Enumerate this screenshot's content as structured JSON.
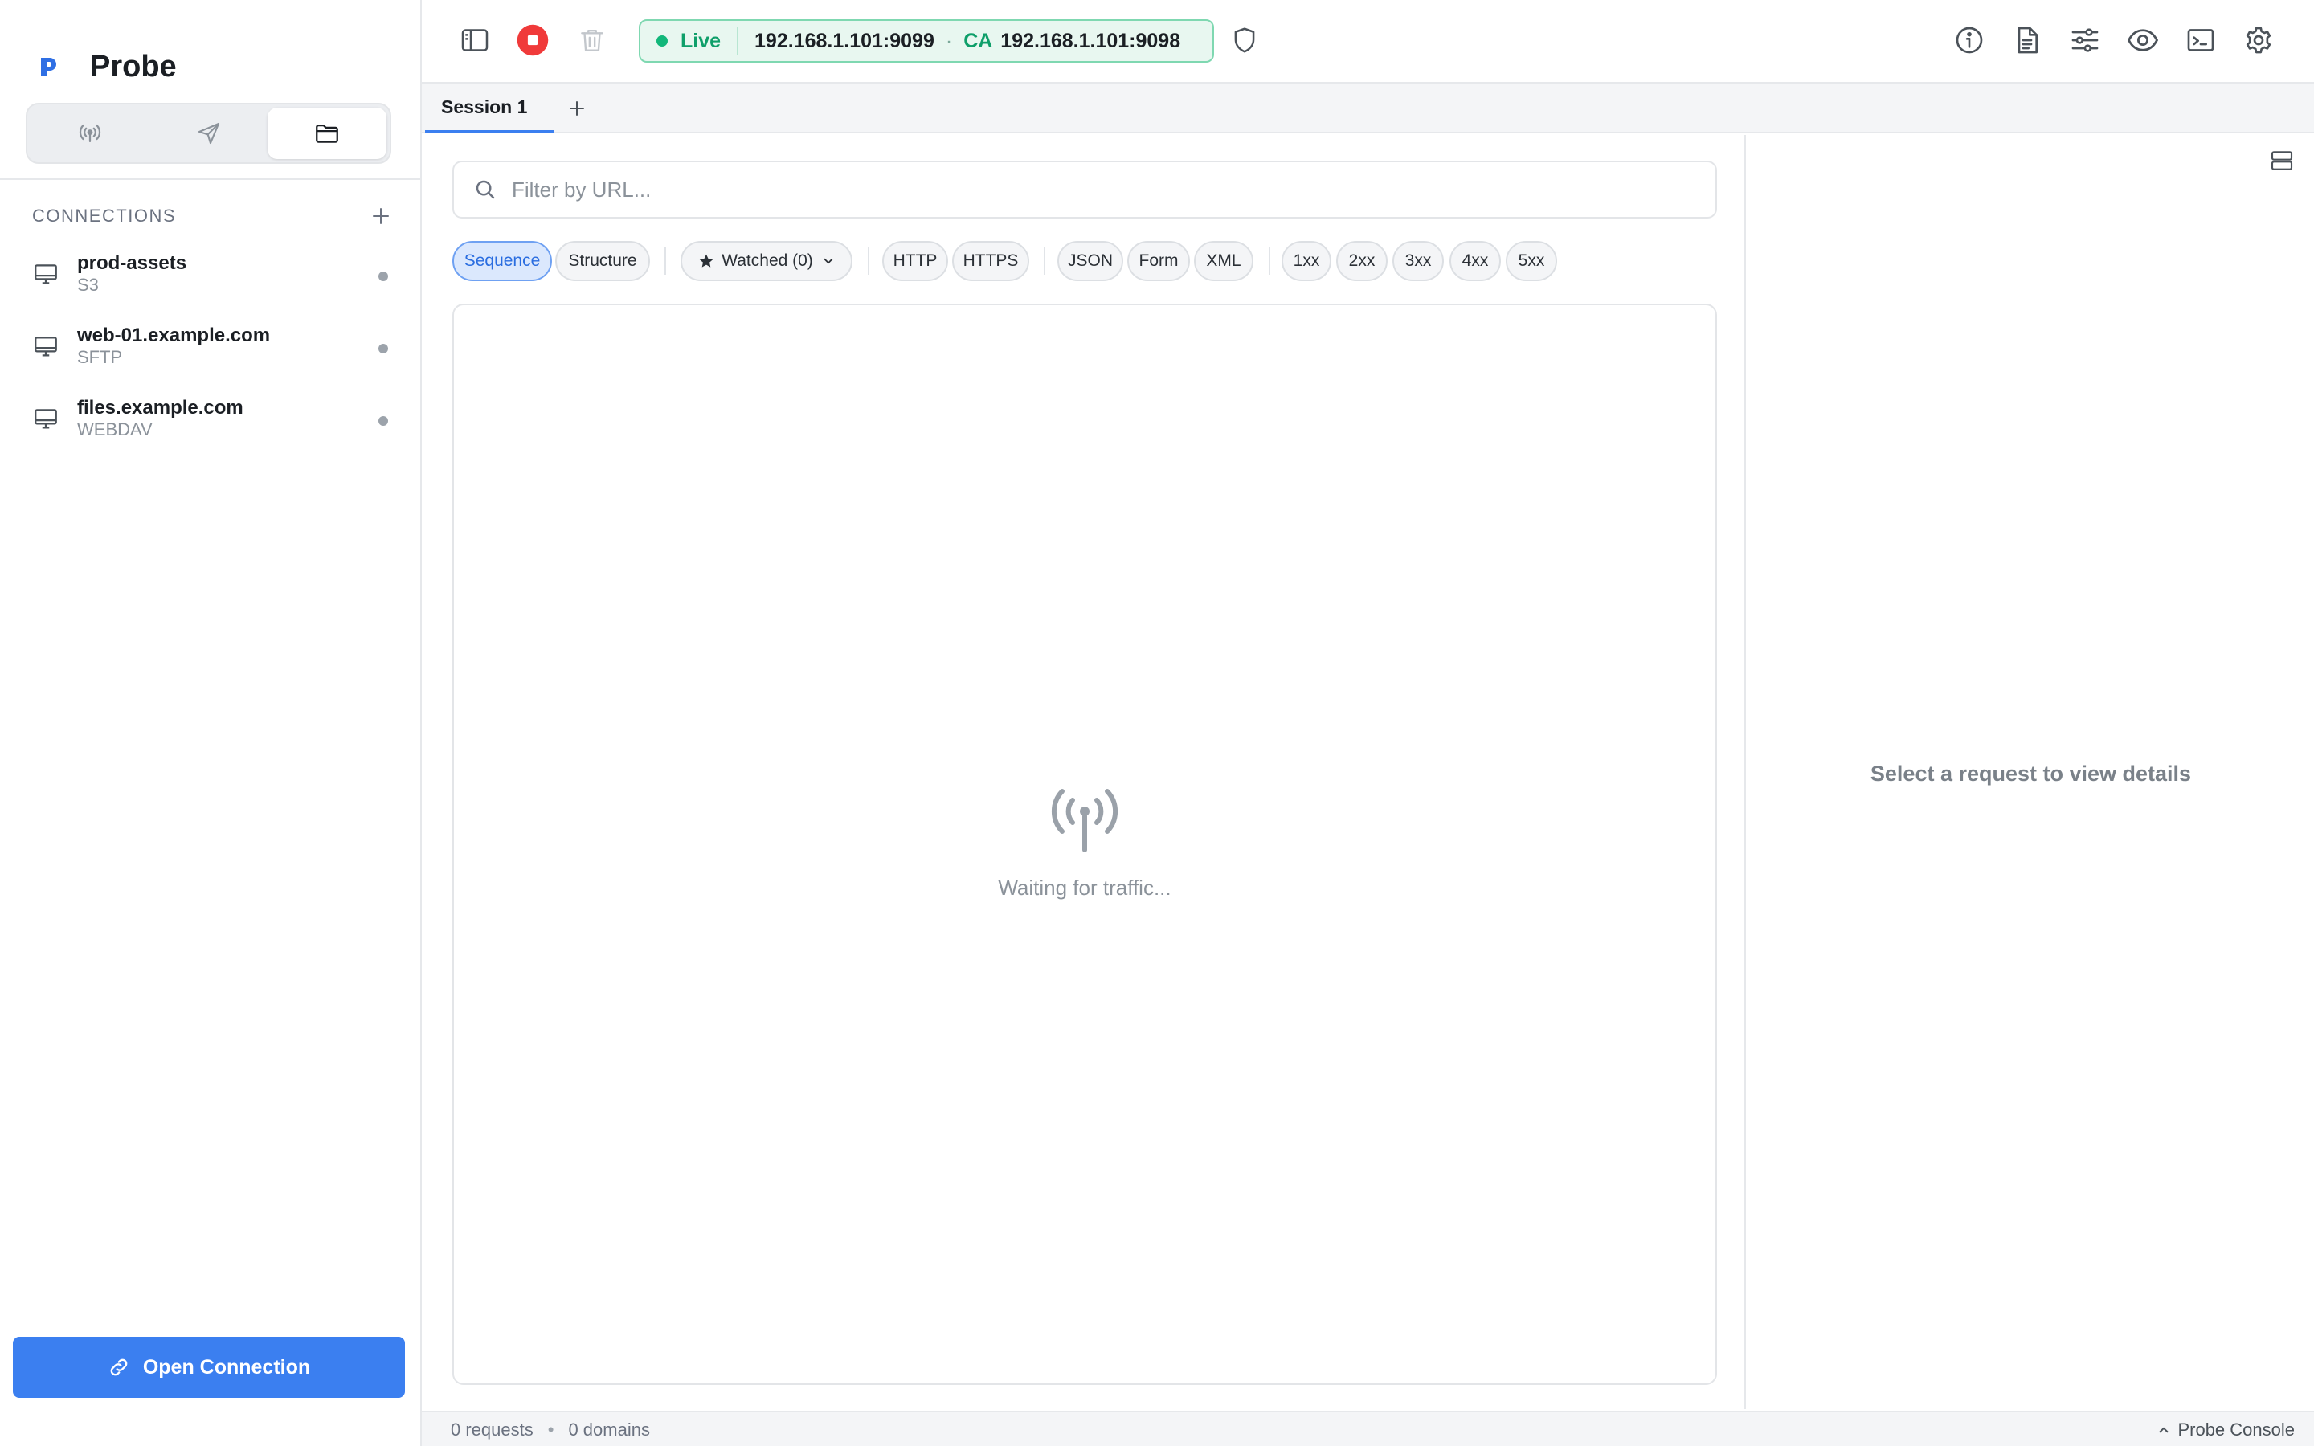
{
  "app": {
    "name": "Probe"
  },
  "sidebar": {
    "modes": [
      {
        "icon": "broadcast-icon"
      },
      {
        "icon": "send-icon"
      },
      {
        "icon": "folder-icon",
        "active": true
      }
    ],
    "connections_title": "CONNECTIONS",
    "connections": [
      {
        "name": "prod-assets",
        "protocol": "S3"
      },
      {
        "name": "web-01.example.com",
        "protocol": "SFTP"
      },
      {
        "name": "files.example.com",
        "protocol": "WEBDAV"
      }
    ],
    "open_button": "Open Connection"
  },
  "toolbar": {
    "live_label": "Live",
    "proxy_address": "192.168.1.101:9099",
    "separator": "·",
    "ca_label": "CA",
    "ca_address": "192.168.1.101:9098",
    "right_icons": [
      "info-icon",
      "document-icon",
      "sliders-icon",
      "eye-icon",
      "terminal-icon",
      "gear-icon"
    ]
  },
  "tabs": [
    {
      "label": "Session 1",
      "active": true
    }
  ],
  "search": {
    "placeholder": "Filter by URL..."
  },
  "filters": {
    "view": [
      "Sequence",
      "Structure"
    ],
    "watched": "Watched (0)",
    "protocols": [
      "HTTP",
      "HTTPS"
    ],
    "formats": [
      "JSON",
      "Form",
      "XML"
    ],
    "status": [
      "1xx",
      "2xx",
      "3xx",
      "4xx",
      "5xx"
    ]
  },
  "traffic": {
    "empty_text": "Waiting for traffic..."
  },
  "detail": {
    "empty_text": "Select a request to view details"
  },
  "status": {
    "requests": "0 requests",
    "separator": "•",
    "domains": "0 domains",
    "console": "Probe Console"
  },
  "colors": {
    "accent": "#3b7ff0",
    "record_red": "#f03a3a",
    "live_green": "#12b77a"
  }
}
